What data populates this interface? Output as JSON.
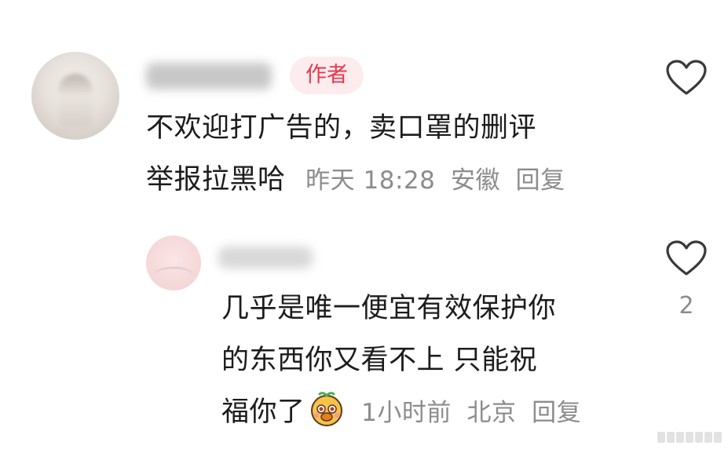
{
  "comment1": {
    "badge": "作者",
    "line1": "不欢迎打广告的，卖口罩的删评",
    "line2": "举报拉黑哈",
    "time": "昨天 18:28",
    "location": "安徽",
    "reply_label": "回复",
    "like_icon": "heart-outline-icon"
  },
  "comment2": {
    "line1": "几乎是唯一便宜有效保护你",
    "line2": "的东西你又看不上 只能祝",
    "line3": "福你了",
    "emoji_icon": "smiling-face-emoji-icon",
    "time": "1小时前",
    "location": "北京",
    "reply_label": "回复",
    "like_icon": "heart-outline-icon",
    "like_count": "2"
  },
  "colors": {
    "badge_text": "#e8364a",
    "badge_bg": "#fdecee",
    "meta_text": "#8c8c8c",
    "heart_stroke": "#3a3a3a"
  }
}
